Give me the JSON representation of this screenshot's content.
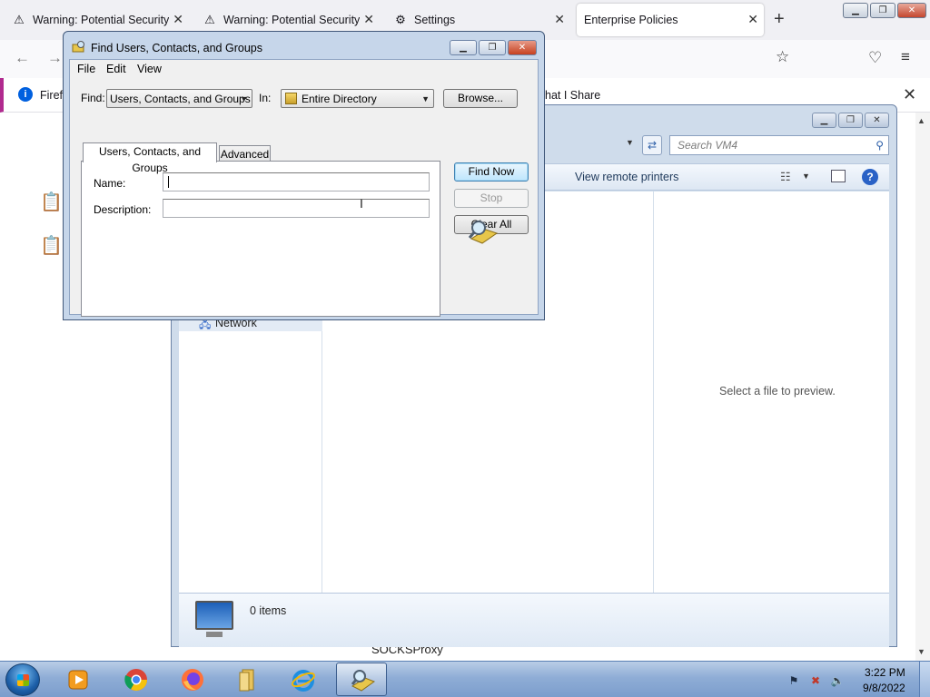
{
  "firefox": {
    "tabs": [
      {
        "label": "Warning: Potential Security R",
        "icon": "warning-icon"
      },
      {
        "label": "Warning: Potential Security R",
        "icon": "warning-icon"
      },
      {
        "label": "Settings",
        "icon": "gear-icon"
      },
      {
        "label": "Enterprise Policies",
        "icon": ""
      }
    ],
    "infobar": {
      "text": "Firefo",
      "share_text": "hat I Share"
    },
    "bottom_label": "SOCKSProxy"
  },
  "explorer": {
    "search_placeholder": "Search VM4",
    "toolbar_partial": "r",
    "view_remote_printers": "View remote printers",
    "nav_network": "Network",
    "preview_text": "Select a file to preview.",
    "items_count": "0 items"
  },
  "find_dialog": {
    "title": "Find Users, Contacts, and Groups",
    "menu": [
      "File",
      "Edit",
      "View"
    ],
    "find_label": "Find:",
    "find_value": "Users, Contacts, and Groups",
    "in_label": "In:",
    "in_value": "Entire Directory",
    "browse_label": "Browse...",
    "tabs": [
      "Users, Contacts, and Groups",
      "Advanced"
    ],
    "name_label": "Name:",
    "name_value": "",
    "description_label": "Description:",
    "description_value": "",
    "find_now_label": "Find Now",
    "stop_label": "Stop",
    "clear_all_label": "Clear All"
  },
  "taskbar": {
    "apps": [
      "windows-media-player-icon",
      "chrome-icon",
      "firefox-icon",
      "folder-icon",
      "internet-explorer-icon",
      "find-users-icon"
    ],
    "time": "3:22 PM",
    "date": "9/8/2022"
  },
  "colors": {
    "accent": "#3c7fb1",
    "dialog_frame": "#c6d6ea",
    "taskbar": "#8fadd6"
  }
}
